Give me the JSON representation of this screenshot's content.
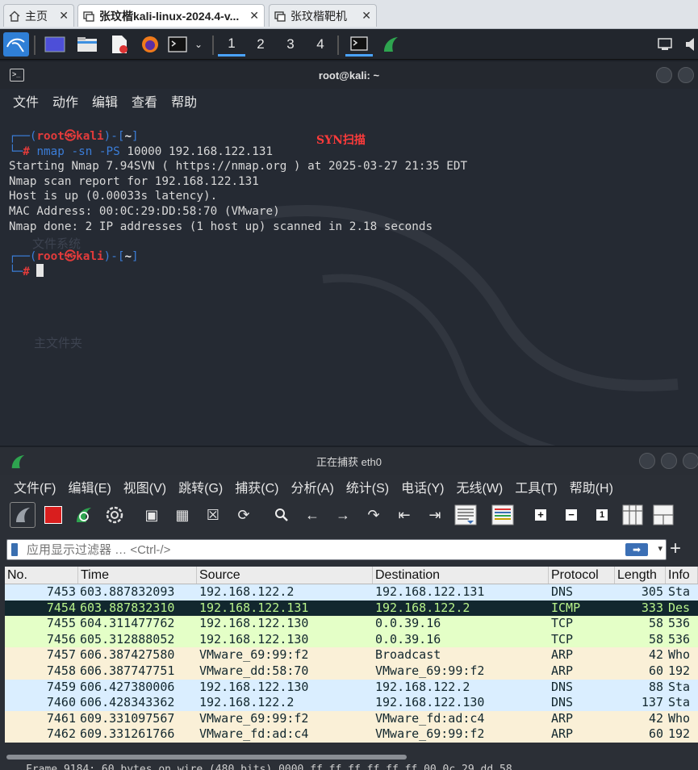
{
  "browser_tabs": [
    {
      "label": "主页",
      "active": false
    },
    {
      "label": "张玟楷kali-linux-2024.4-v...",
      "active": true
    },
    {
      "label": "张玟楷靶机",
      "active": false
    }
  ],
  "panel": {
    "workspaces": [
      "1",
      "2",
      "3",
      "4"
    ],
    "active_workspace": "1"
  },
  "terminal": {
    "title": "root@kali: ~",
    "menu": [
      "文件",
      "动作",
      "编辑",
      "查看",
      "帮助"
    ],
    "annotation": "SYN扫描",
    "prompt_user": "root",
    "prompt_at": "㉿",
    "prompt_host": "kali",
    "prompt_dir": "~",
    "command": "nmap -sn -PS 10000 192.168.122.131",
    "cmd_name": "nmap",
    "cmd_flags": " -sn -PS",
    "cmd_args": " 10000 192.168.122.131",
    "output": [
      "Starting Nmap 7.94SVN ( https://nmap.org ) at 2025-03-27 21:35 EDT",
      "Nmap scan report for 192.168.122.131",
      "Host is up (0.00033s latency).",
      "MAC Address: 00:0C:29:DD:58:70 (VMware)",
      "Nmap done: 2 IP addresses (1 host up) scanned in 2.18 seconds"
    ],
    "desktop_ghost_labels": [
      "文件系统",
      "主文件夹"
    ]
  },
  "wireshark": {
    "title": "正在捕获 eth0",
    "menu": [
      "文件(F)",
      "编辑(E)",
      "视图(V)",
      "跳转(G)",
      "捕获(C)",
      "分析(A)",
      "统计(S)",
      "电话(Y)",
      "无线(W)",
      "工具(T)",
      "帮助(H)"
    ],
    "filter_placeholder": "应用显示过滤器 … <Ctrl-/>",
    "columns": [
      "No.",
      "Time",
      "Source",
      "Destination",
      "Protocol",
      "Length",
      "Info"
    ],
    "packets": [
      {
        "no": "7453",
        "time": "603.887832093",
        "src": "192.168.122.2",
        "dst": "192.168.122.131",
        "proto": "DNS",
        "len": "305",
        "info": "Sta",
        "bg": "#daeeff",
        "fg": "#12272e"
      },
      {
        "no": "7454",
        "time": "603.887832310",
        "src": "192.168.122.131",
        "dst": "192.168.122.2",
        "proto": "ICMP",
        "len": "333",
        "info": "Des",
        "bg": "#12272e",
        "fg": "#b8f28a"
      },
      {
        "no": "7455",
        "time": "604.311477762",
        "src": "192.168.122.130",
        "dst": "0.0.39.16",
        "proto": "TCP",
        "len": "58",
        "info": "536",
        "bg": "#e4ffc7",
        "fg": "#12272e"
      },
      {
        "no": "7456",
        "time": "605.312888052",
        "src": "192.168.122.130",
        "dst": "0.0.39.16",
        "proto": "TCP",
        "len": "58",
        "info": "536",
        "bg": "#e4ffc7",
        "fg": "#12272e"
      },
      {
        "no": "7457",
        "time": "606.387427580",
        "src": "VMware_69:99:f2",
        "dst": "Broadcast",
        "proto": "ARP",
        "len": "42",
        "info": "Who",
        "bg": "#faf0d7",
        "fg": "#12272e"
      },
      {
        "no": "7458",
        "time": "606.387747751",
        "src": "VMware_dd:58:70",
        "dst": "VMware_69:99:f2",
        "proto": "ARP",
        "len": "60",
        "info": "192",
        "bg": "#faf0d7",
        "fg": "#12272e"
      },
      {
        "no": "7459",
        "time": "606.427380006",
        "src": "192.168.122.130",
        "dst": "192.168.122.2",
        "proto": "DNS",
        "len": "88",
        "info": "Sta",
        "bg": "#daeeff",
        "fg": "#12272e"
      },
      {
        "no": "7460",
        "time": "606.428343362",
        "src": "192.168.122.2",
        "dst": "192.168.122.130",
        "proto": "DNS",
        "len": "137",
        "info": "Sta",
        "bg": "#daeeff",
        "fg": "#12272e"
      },
      {
        "no": "7461",
        "time": "609.331097567",
        "src": "VMware_69:99:f2",
        "dst": "VMware_fd:ad:c4",
        "proto": "ARP",
        "len": "42",
        "info": "Who",
        "bg": "#faf0d7",
        "fg": "#12272e"
      },
      {
        "no": "7462",
        "time": "609.331261766",
        "src": "VMware_fd:ad:c4",
        "dst": "VMware_69:99:f2",
        "proto": "ARP",
        "len": "60",
        "info": "192",
        "bg": "#faf0d7",
        "fg": "#12272e"
      }
    ],
    "detail_line": "Frame 9184: 60 bytes on wire (480 bits)   0000  ff ff ff ff ff ff 00 0c 29 dd 58"
  }
}
